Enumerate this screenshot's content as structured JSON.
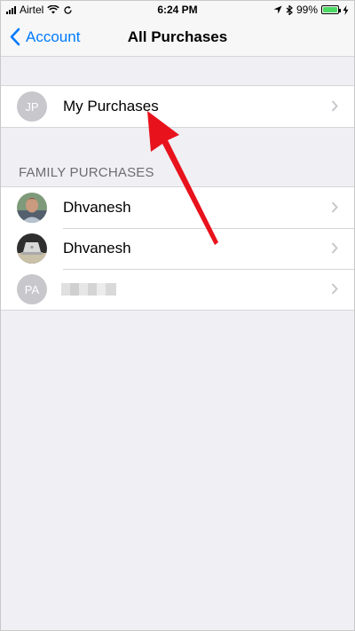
{
  "status_bar": {
    "carrier": "Airtel",
    "time": "6:24 PM",
    "battery_percent": "99%",
    "battery_level": 0.99,
    "battery_color": "#4cd964"
  },
  "nav": {
    "back_label": "Account",
    "title": "All Purchases",
    "accent_color": "#007aff"
  },
  "my_purchases": {
    "initials": "JP",
    "label": "My Purchases"
  },
  "family": {
    "header": "FAMILY PURCHASES",
    "members": [
      {
        "label": "Dhvanesh",
        "avatar": "photo-avatar"
      },
      {
        "label": "Dhvanesh",
        "avatar": "laptop-photo-avatar"
      },
      {
        "initials": "PA",
        "label": "",
        "avatar": "initials-avatar"
      }
    ]
  },
  "annotation": {
    "arrow_color": "#e8121c"
  }
}
